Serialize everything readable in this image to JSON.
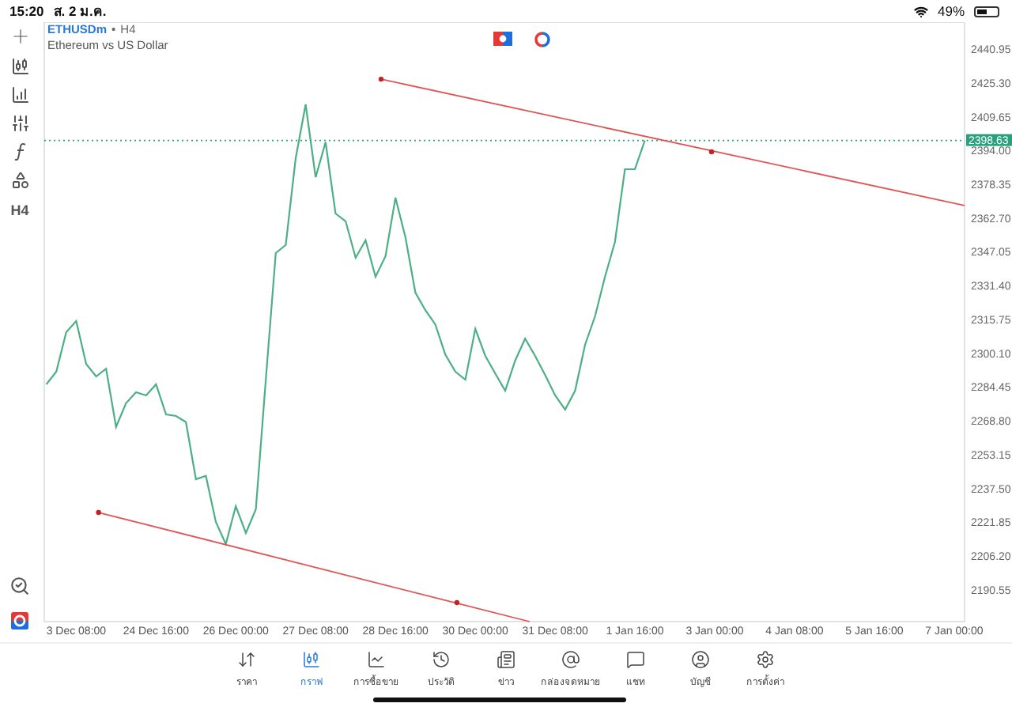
{
  "status_bar": {
    "time": "15:20",
    "date": "ส. 2 ม.ค.",
    "battery": "49%"
  },
  "toolbar": {
    "timeframe": "H4"
  },
  "chart_header": {
    "symbol": "ETHUSDm",
    "separator": "•",
    "timeframe": "H4",
    "description": "Ethereum vs US Dollar"
  },
  "chart": {
    "chart_data": {
      "type": "line",
      "ref_lines": [
        {
          "axis": "y",
          "value": 2398.63,
          "label": "2398.63",
          "color": "#26a17b"
        }
      ],
      "categories": [
        null,
        null,
        null,
        "3 Dec 08:00",
        null,
        null,
        null,
        null,
        null,
        null,
        null,
        "24 Dec 16:00",
        null,
        null,
        null,
        null,
        null,
        null,
        null,
        "26 Dec 00:00",
        null,
        null,
        null,
        null,
        null,
        null,
        null,
        "27 Dec 08:00",
        null,
        null,
        null,
        null,
        null,
        null,
        null,
        "28 Dec 16:00",
        null,
        null,
        null,
        null,
        null,
        null,
        null,
        "30 Dec 00:00",
        null,
        null,
        null,
        null,
        null,
        null,
        null,
        "31 Dec 08:00",
        null,
        null,
        null,
        null,
        null,
        null,
        null,
        "1 Jan 16:00",
        null,
        null,
        null,
        null,
        null,
        null,
        null,
        "3 Jan 00:00",
        null,
        null,
        null,
        null,
        null,
        null,
        null,
        "4 Jan 08:00",
        null,
        null,
        null,
        null,
        null,
        null,
        null,
        "5 Jan 16:00",
        null,
        null,
        null,
        null,
        null,
        null,
        null,
        "7 Jan 00:00"
      ],
      "series": [
        {
          "color": "#4caf86",
          "values": [
            2285.7,
            2291.6,
            2309.9,
            2315.0,
            2295.2,
            2289.4,
            2293.0,
            2266.0,
            2277.0,
            2282.1,
            2280.6,
            2285.7,
            2271.8,
            2271.1,
            2268.2,
            2241.8,
            2243.3,
            2222.0,
            2211.8,
            2229.3,
            2216.9,
            2227.9,
            2287.9,
            2346.5,
            2350.2,
            2390.4,
            2415.3,
            2381.6,
            2397.8,
            2364.8,
            2361.2,
            2344.3,
            2352.4,
            2335.5,
            2345.0,
            2372.1,
            2353.8,
            2328.2,
            2320.1,
            2313.5,
            2299.6,
            2291.6,
            2287.9,
            2311.4,
            2298.9,
            2290.8,
            2282.8,
            2296.7,
            2306.9,
            2298.9,
            2290.1,
            2280.6,
            2274.0,
            2282.8,
            2304.0,
            2317.2,
            2335.5,
            2351.6,
            2385.3,
            2385.3,
            2398.6,
            null,
            null,
            null,
            null,
            null,
            null,
            null,
            null,
            null,
            null,
            null,
            null,
            null,
            null,
            null,
            null,
            null,
            null,
            null,
            null,
            null,
            null,
            null,
            null,
            null,
            null,
            null,
            null,
            null,
            null,
            null
          ]
        }
      ],
      "ylim": [
        2175.9,
        2453.4
      ],
      "yticks": [
        {
          "value": 2440.95,
          "label": "2440.95"
        },
        {
          "value": 2425.3,
          "label": "2425.30"
        },
        {
          "value": 2409.65,
          "label": "2409.65"
        },
        {
          "value": 2394.0,
          "label": "2394.00"
        },
        {
          "value": 2378.35,
          "label": "2378.35"
        },
        {
          "value": 2362.7,
          "label": "2362.70"
        },
        {
          "value": 2347.05,
          "label": "2347.05"
        },
        {
          "value": 2331.4,
          "label": "2331.40"
        },
        {
          "value": 2315.75,
          "label": "2315.75"
        },
        {
          "value": 2300.1,
          "label": "2300.10"
        },
        {
          "value": 2284.45,
          "label": "2284.45"
        },
        {
          "value": 2268.8,
          "label": "2268.80"
        },
        {
          "value": 2253.15,
          "label": "2253.15"
        },
        {
          "value": 2237.5,
          "label": "2237.50"
        },
        {
          "value": 2221.85,
          "label": "2221.85"
        },
        {
          "value": 2206.2,
          "label": "2206.20"
        },
        {
          "value": 2190.55,
          "label": "2190.55"
        }
      ]
    }
  },
  "tabs": [
    {
      "label": "ราคา",
      "selected": false
    },
    {
      "label": "กราฟ",
      "selected": true
    },
    {
      "label": "การซื้อขาย",
      "selected": false
    },
    {
      "label": "ประวัติ",
      "selected": false
    },
    {
      "label": "ข่าว",
      "selected": false
    },
    {
      "label": "กล่องจดหมาย",
      "selected": false
    },
    {
      "label": "แชท",
      "selected": false
    },
    {
      "label": "บัญชี",
      "selected": false
    },
    {
      "label": "การตั้งค่า",
      "selected": false
    }
  ]
}
